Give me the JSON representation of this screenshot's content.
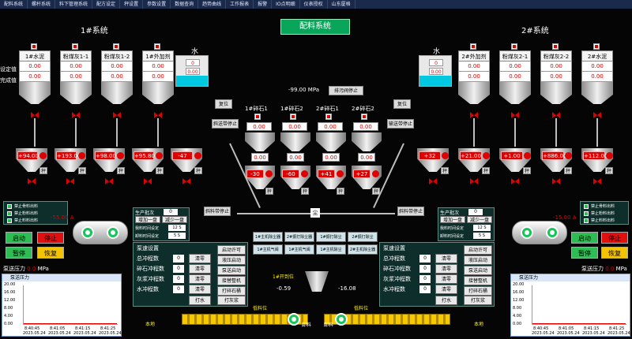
{
  "menu": [
    "配料系统",
    "螺杆系统",
    "料下管理系统",
    "配方设定",
    "秤设置",
    "参数设置",
    "数据查询",
    "趋势曲线",
    "工作报表",
    "报警",
    "IO点明细",
    "仪表授权",
    "山东厦格"
  ],
  "main_title": "配料系统",
  "left_system_title": "1#系统",
  "right_system_title": "2#系统",
  "left_row_labels": {
    "set": "设定值",
    "done": "完成值"
  },
  "left_silos": [
    {
      "name": "1#水泥",
      "set": "0.00",
      "done": "0.00"
    },
    {
      "name": "粉煤灰1-1",
      "set": "0.00",
      "done": "0.00"
    },
    {
      "name": "粉煤灰1-2",
      "set": "0.00",
      "done": "0.00"
    },
    {
      "name": "1#外加剂",
      "set": "0.00",
      "done": "0.00"
    }
  ],
  "right_silos": [
    {
      "name": "2#外加剂",
      "set": "0.00",
      "done": "0.00"
    },
    {
      "name": "粉煤灰2-1",
      "set": "0.00",
      "done": "0.00"
    },
    {
      "name": "粉煤灰2-2",
      "set": "0.00",
      "done": "0.00"
    },
    {
      "name": "2#水泥",
      "set": "0.00",
      "done": "0.00"
    }
  ],
  "water": {
    "label": "水",
    "left": {
      "v1": "0",
      "v2": "0.00"
    },
    "right": {
      "v1": "0",
      "v2": "0.00"
    }
  },
  "pressure_top": "-99.00 MPa",
  "btn_top": "排污阀停止",
  "reset_label": "复位",
  "btn_left_belt": "斜送带停止",
  "btn_right_belt": "输送带停止",
  "stones": [
    {
      "name": "1#碎石1",
      "set": "0.00",
      "done": "0.00"
    },
    {
      "name": "1#碎石2",
      "set": "0.00",
      "done": "0.00"
    },
    {
      "name": "2#碎石1",
      "set": "0.00",
      "done": "0.00"
    },
    {
      "name": "2#碎石2",
      "set": "0.00",
      "done": "0.00"
    }
  ],
  "left_weigh": [
    "+94.00",
    "+193.00",
    "+98.00",
    "+95.80",
    "-47"
  ],
  "right_weigh": [
    "+32",
    "+21.00",
    "+1.00",
    "+886.00",
    "+112.00"
  ],
  "stone_weigh": [
    "-30",
    "-60",
    "+41",
    "+27"
  ],
  "weigh_tag": "秤",
  "left_belt_stop": "斜料带停止",
  "right_belt_stop": "斜料带停止",
  "dust_icon_label": "尘",
  "alarms_left": [
    "禁止骨料出料",
    "禁止粉料出料",
    "禁止料料出料"
  ],
  "alarms_right": [
    "禁止骨料出料",
    "禁止粉料出料",
    "禁止料料出料"
  ],
  "left_mixer_pct": "-55.00 A",
  "right_mixer_pct": "-15.00 A",
  "left_ctrl": {
    "start": "启动",
    "stop": "停止",
    "pause": "暂停",
    "resume": "恢复"
  },
  "right_ctrl": {
    "start": "启动",
    "stop": "停止",
    "pause": "暂停",
    "resume": "恢复"
  },
  "left_prod": {
    "title": "生产批次",
    "count": "0",
    "btn1": "增加一盘",
    "btn2": "减少一盘",
    "l1": "我料时间设定",
    "v1": "12 S",
    "l2": "卸料时间设定",
    "v2": "5 S"
  },
  "right_prod": {
    "title": "生产批次",
    "count": "0",
    "btn1": "增加一盘",
    "btn2": "减少一盘",
    "l1": "我料时间设定",
    "v1": "12 S",
    "l2": "卸料时间设定",
    "v2": "5 S"
  },
  "left_pump": {
    "title": "泵速设置",
    "rows": [
      {
        "label": "总冲程数",
        "v": "0"
      },
      {
        "label": "碎石冲程数",
        "v": "0"
      },
      {
        "label": "灰浆冲程数",
        "v": "0"
      },
      {
        "label": "水冲程数",
        "v": "0"
      }
    ],
    "zero": "清零",
    "btns": [
      "启动许可",
      "液压启动",
      "泵送启动",
      "接替整机",
      "打碎石桶"
    ],
    "b1": "打水",
    "b2": "打灰浆"
  },
  "right_pump": {
    "title": "泵速设置",
    "rows": [
      {
        "label": "总冲程数",
        "v": "0"
      },
      {
        "label": "碎石冲程数",
        "v": "0"
      },
      {
        "label": "灰浆冲程数",
        "v": "0"
      },
      {
        "label": "水冲程数",
        "v": "0"
      }
    ],
    "zero": "清零",
    "btns": [
      "启动许可",
      "液压启动",
      "泵送启动",
      "接替整机",
      "打碎石桶"
    ],
    "b1": "打水",
    "b2": "打灰浆"
  },
  "center_buttons": [
    "1#主机除尘器",
    "2#振打除尘器",
    "1#振打除尘",
    "2#振打除尘",
    "1#主机气阀",
    "1#主机气阀",
    "1#主机除尘",
    "2#主机除尘器"
  ],
  "left_pressure": {
    "label": "泵送压力",
    "value": "0.0",
    "unit": "MPa"
  },
  "right_pressure": {
    "label": "泵送压力",
    "value": "0.0",
    "unit": "MPa"
  },
  "center_pos_label": "1#开到位",
  "center_left_val": "-0.59",
  "center_right_val": "-16.08",
  "feed_left": "低料位",
  "feed_right": "低料位",
  "local_l": "本地",
  "local_r": "本地",
  "discharge_l": "卸料",
  "discharge_r": "卸料",
  "chart_left": {
    "title": "泵送压力",
    "yticks": [
      "20.00",
      "16.00",
      "12.00",
      "8.00",
      "4.00",
      "0.00"
    ],
    "xticks": [
      "8:40:45",
      "8:41:05",
      "8:41:15",
      "8:41:25"
    ],
    "date": "2023.05.24"
  },
  "chart_right": {
    "title": "泵送压力",
    "yticks": [
      "20.00",
      "16.00",
      "12.00",
      "8.00",
      "4.00",
      "0.00"
    ],
    "xticks": [
      "8:40:45",
      "8:41:05",
      "8:41:15",
      "8:41:25"
    ],
    "date": "2023.05.24"
  }
}
